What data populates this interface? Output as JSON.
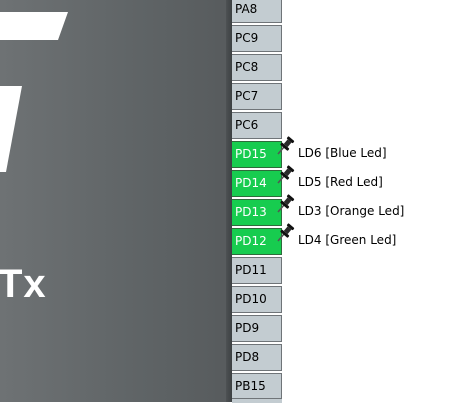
{
  "chip": {
    "label": "Tx",
    "body_color": "#62676a"
  },
  "pins": [
    {
      "name": "PA8",
      "active": false
    },
    {
      "name": "PC9",
      "active": false
    },
    {
      "name": "PC8",
      "active": false
    },
    {
      "name": "PC7",
      "active": false
    },
    {
      "name": "PC6",
      "active": false
    },
    {
      "name": "PD15",
      "active": true,
      "label": "LD6 [Blue Led]"
    },
    {
      "name": "PD14",
      "active": true,
      "label": "LD5 [Red Led]"
    },
    {
      "name": "PD13",
      "active": true,
      "label": "LD3 [Orange Led]"
    },
    {
      "name": "PD12",
      "active": true,
      "label": "LD4 [Green Led]"
    },
    {
      "name": "PD11",
      "active": false
    },
    {
      "name": "PD10",
      "active": false
    },
    {
      "name": "PD9",
      "active": false
    },
    {
      "name": "PD8",
      "active": false
    },
    {
      "name": "PB15",
      "active": false
    }
  ],
  "colors": {
    "pin_default": "#c3ccd1",
    "pin_active": "#17cc4f"
  },
  "icons": {
    "pushpin": "pushpin-icon"
  }
}
